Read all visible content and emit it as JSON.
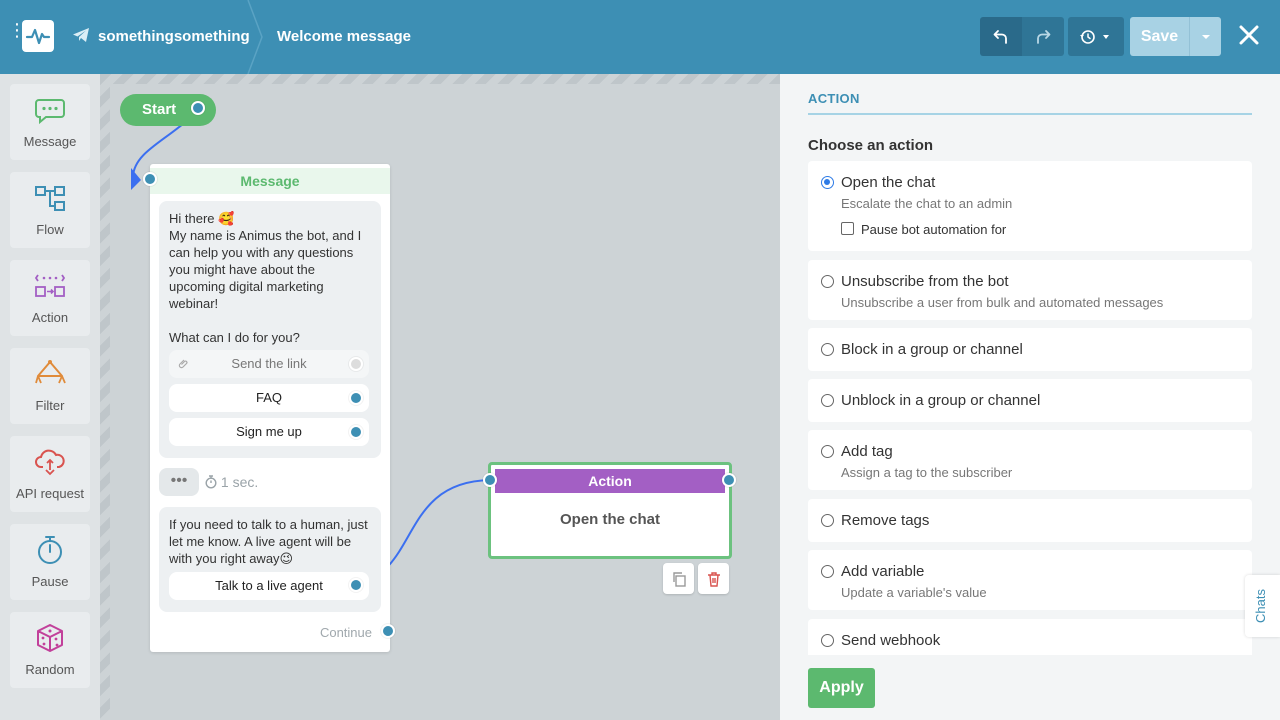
{
  "header": {
    "bot_name": "somethingsomething",
    "flow_title": "Welcome message",
    "save_label": "Save"
  },
  "toolbox": [
    {
      "label": "Message",
      "icon": "message-icon",
      "color": "#5cb96f"
    },
    {
      "label": "Flow",
      "icon": "flow-icon",
      "color": "#3d8fb4"
    },
    {
      "label": "Action",
      "icon": "action-icon",
      "color": "#a35fc4"
    },
    {
      "label": "Filter",
      "icon": "filter-icon",
      "color": "#e08b3a"
    },
    {
      "label": "API request",
      "icon": "api-request-icon",
      "color": "#d9534f"
    },
    {
      "label": "Pause",
      "icon": "pause-icon",
      "color": "#3d8fb4"
    },
    {
      "label": "Random",
      "icon": "random-icon",
      "color": "#c2409a"
    }
  ],
  "canvas": {
    "start_label": "Start",
    "message_node": {
      "title": "Message",
      "text1_line1": "Hi there 🥰",
      "text1_body": "My name is Animus the bot, and I can help you with any questions you might have about the upcoming digital marketing webinar!",
      "text1_question": "What can I do for you?",
      "buttons": [
        "Send the link",
        "FAQ",
        "Sign me up"
      ],
      "delay": "1 sec.",
      "text2": "If you need to talk to a human, just let me know. A live agent will be with you right away😉",
      "button2": "Talk to a live agent",
      "continue_label": "Continue"
    },
    "action_node": {
      "title": "Action",
      "body": "Open the chat"
    }
  },
  "panel": {
    "section_title": "ACTION",
    "heading": "Choose an action",
    "options": [
      {
        "label": "Open the chat",
        "sub": "Escalate the chat to an admin",
        "selected": true
      },
      {
        "label": "Unsubscribe from the bot",
        "sub": "Unsubscribe a user from bulk and automated messages"
      },
      {
        "label": "Block in a group or channel"
      },
      {
        "label": "Unblock in a group or channel"
      },
      {
        "label": "Add tag",
        "sub": "Assign a tag to the subscriber"
      },
      {
        "label": "Remove tags"
      },
      {
        "label": "Add variable",
        "sub": "Update a variable's value"
      },
      {
        "label": "Send webhook"
      }
    ],
    "pause_checkbox_label": "Pause bot automation for",
    "apply_label": "Apply",
    "chats_tab": "Chats"
  },
  "colors": {
    "header": "#3d8fb4",
    "accent_green": "#5cb96f",
    "action_purple": "#a35fc4",
    "port_blue": "#3d8fb4"
  }
}
